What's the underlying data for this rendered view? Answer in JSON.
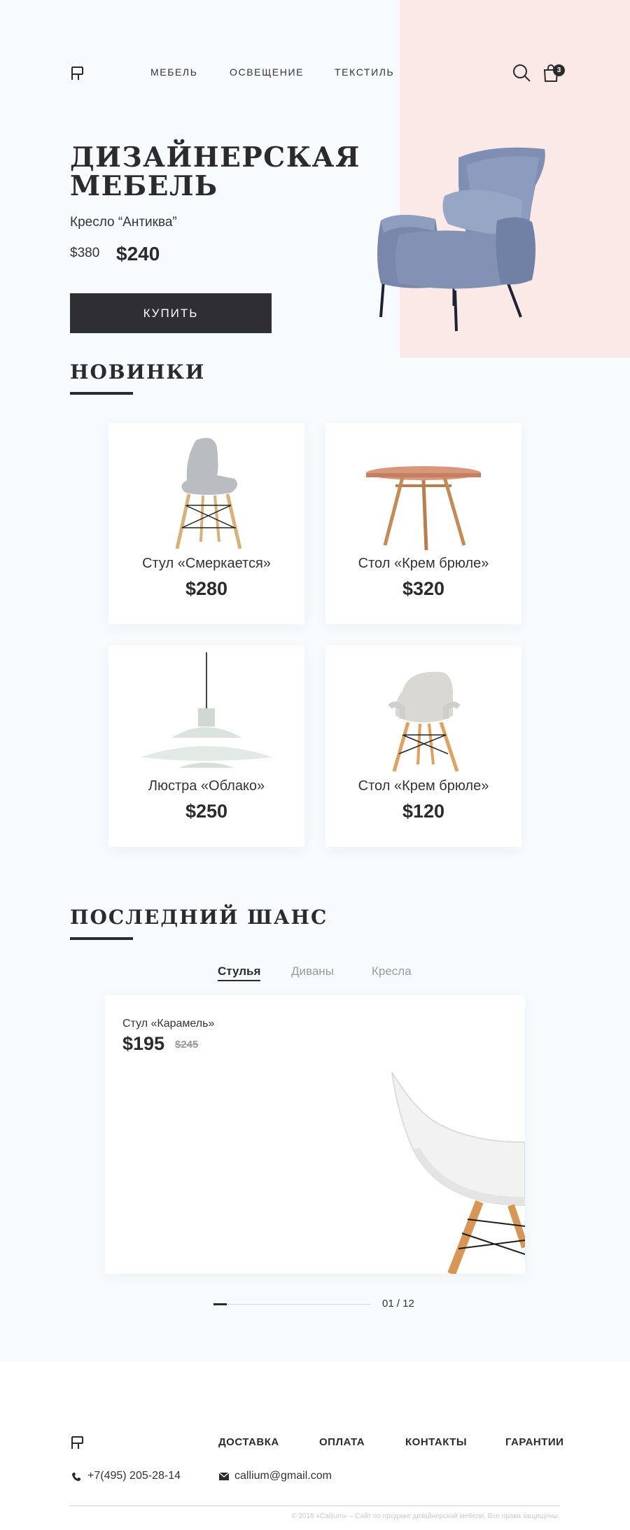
{
  "colors": {
    "accent": "#2b2b2e",
    "hero_panel": "#fbe9e8",
    "page_bg": "#f8fbfe",
    "muted": "#9a9a9a"
  },
  "header": {
    "logo_icon": "logo-chair-mark",
    "nav": [
      "МЕБЕЛЬ",
      "ОСВЕЩЕНИЕ",
      "ТЕКСТИЛЬ"
    ],
    "search_icon": "search-icon",
    "cart_icon": "cart-icon",
    "cart_count": "3"
  },
  "hero": {
    "title": "ДИЗАЙНЕРСКАЯ МЕБЕЛЬ",
    "subtitle": "Кресло “Антиква”",
    "old_price": "$380",
    "new_price": "$240",
    "buy_label": "КУПИТЬ"
  },
  "new_section": {
    "title": "НОВИНКИ",
    "products": [
      {
        "name": "Стул «Смеркается»",
        "price": "$280",
        "icon": "chair-icon"
      },
      {
        "name": "Стол «Крем брюле»",
        "price": "$320",
        "icon": "table-icon"
      },
      {
        "name": "Люстра «Облако»",
        "price": "$250",
        "icon": "lamp-icon"
      },
      {
        "name": "Стол «Крем брюле»",
        "price": "$120",
        "icon": "armchair-icon"
      }
    ]
  },
  "last_chance": {
    "title": "ПОСЛЕДНИЙ ШАНС",
    "tabs": [
      "Стулья",
      "Диваны",
      "Кресла"
    ],
    "active_tab": "Стулья",
    "slide": {
      "name": "Стул «Карамель»",
      "price": "$195",
      "old_price": "$245"
    },
    "pager": {
      "current": 1,
      "total": 12,
      "label": "01 / 12"
    }
  },
  "footer": {
    "logo_icon": "logo-chair-mark",
    "nav": [
      "ДОСТАВКА",
      "ОПЛАТА",
      "КОНТАКТЫ",
      "ГАРАНТИИ"
    ],
    "phone": "+7(495) 205-28-14",
    "email": "callium@gmail.com",
    "copyright": "© 2018 «Callium» – Сайт по продаже дизайнерской мебели. Все права защищены."
  }
}
